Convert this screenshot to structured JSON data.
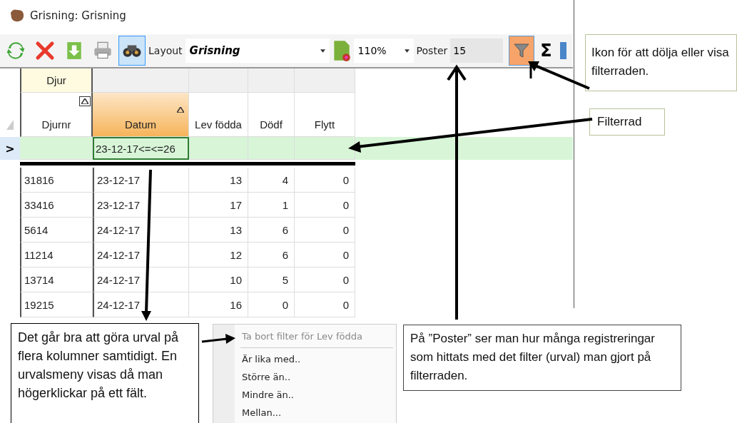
{
  "window": {
    "title": "Grisning: Grisning"
  },
  "toolbar": {
    "tools": [
      {
        "kind": "refresh",
        "selected": false
      },
      {
        "kind": "delete",
        "selected": false
      },
      {
        "kind": "export",
        "selected": false
      },
      {
        "kind": "print",
        "selected": false
      },
      {
        "kind": "search",
        "selected": true
      }
    ],
    "layout_label": "Layout",
    "layout_value": "Grisning",
    "zoom": "110%",
    "records_label": "Poster",
    "records_count": "15",
    "filter_toggle": {
      "selected": true
    },
    "sum": "Σ"
  },
  "grid": {
    "band": "Djur",
    "columns": [
      {
        "label": "Djurnr",
        "sorted": true,
        "selected": false,
        "numeric": false
      },
      {
        "label": "Datum",
        "sorted": true,
        "selected": true,
        "numeric": false
      },
      {
        "label": "Lev födda",
        "sorted": false,
        "selected": false,
        "numeric": true
      },
      {
        "label": "Dödf",
        "sorted": false,
        "selected": false,
        "numeric": true
      },
      {
        "label": "Flytt",
        "sorted": false,
        "selected": false,
        "numeric": true
      }
    ],
    "filter": {
      "marker": ">",
      "cells": [
        {
          "selected": false
        },
        {
          "selected": true,
          "value": "23-12-17<=<=26"
        },
        {
          "selected": false
        },
        {
          "selected": false
        },
        {
          "selected": false
        }
      ]
    },
    "rows": [
      [
        "31816",
        "23-12-17",
        "13",
        "4",
        "0"
      ],
      [
        "33416",
        "23-12-17",
        "17",
        "1",
        "0"
      ],
      [
        "5614",
        "24-12-17",
        "13",
        "6",
        "0"
      ],
      [
        "11214",
        "24-12-17",
        "12",
        "6",
        "0"
      ],
      [
        "13714",
        "24-12-17",
        "10",
        "5",
        "0"
      ],
      [
        "19215",
        "24-12-17",
        "16",
        "0",
        "0"
      ]
    ]
  },
  "callouts": [
    {
      "text": "Ikon för att dölja eller visa filterraden."
    },
    {
      "text": "Filterrad"
    },
    {
      "text": "Det går bra att göra urval på flera kolumner samtidigt. En urvalsmeny visas då man högerklickar på ett fält."
    },
    {
      "text": "På ”Poster” ser man hur många registreringar som hittats med det filter (urval) man gjort på filterraden."
    }
  ],
  "context_menu": {
    "items": [
      {
        "kind": "item",
        "label": "Ta bort filter för Lev födda",
        "disabled": true
      },
      {
        "kind": "separator"
      },
      {
        "kind": "item",
        "label": "Är lika med..",
        "disabled": false
      },
      {
        "kind": "item",
        "label": "Större än..",
        "disabled": false
      },
      {
        "kind": "item",
        "label": "Mindre än..",
        "disabled": false
      },
      {
        "kind": "item",
        "label": "Mellan...",
        "disabled": false
      }
    ]
  }
}
